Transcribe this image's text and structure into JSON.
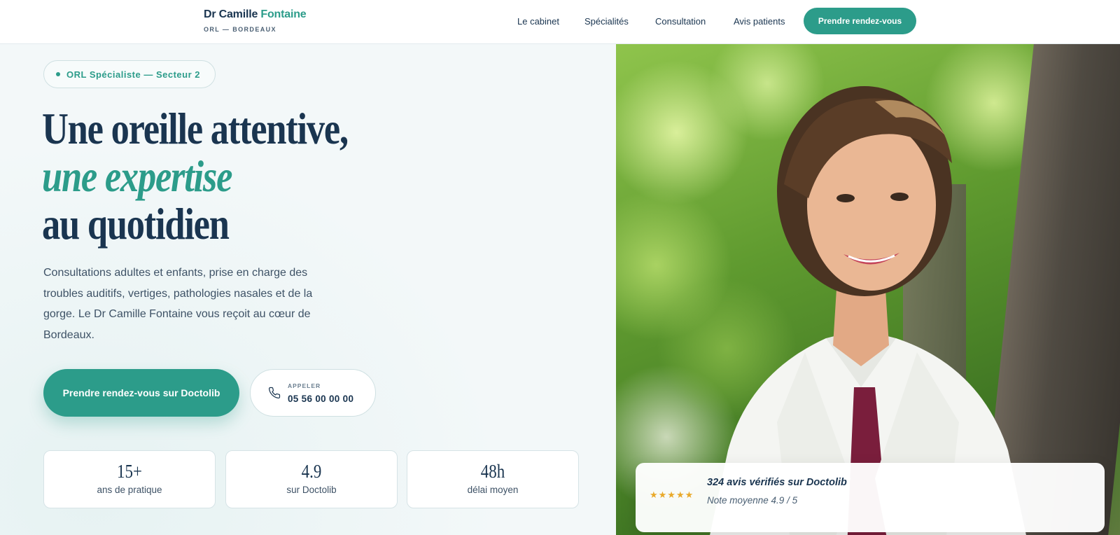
{
  "header": {
    "brand_first": "Dr Camille",
    "brand_accent": "Fontaine",
    "brand_sub": "ORL — BORDEAUX",
    "nav": [
      "Le cabinet",
      "Spécialités",
      "Consultation",
      "Avis patients"
    ],
    "cta": "Prendre rendez-vous"
  },
  "hero": {
    "badge": "ORL Spécialiste — Secteur 2",
    "title_line1": "Une oreille attentive,",
    "title_line2": "une expertise",
    "title_line3": "au quotidien",
    "lead": "Consultations adultes et enfants, prise en charge des troubles auditifs, vertiges, pathologies nasales et de la gorge. Le Dr Camille Fontaine vous reçoit au cœur de Bordeaux.",
    "cta_primary": "Prendre rendez-vous sur Doctolib",
    "call_label": "APPELER",
    "call_number": "05 56 00 00 00"
  },
  "stats": [
    {
      "value": "15+",
      "label": "ans de pratique"
    },
    {
      "value": "4.9",
      "label": "sur Doctolib"
    },
    {
      "value": "48h",
      "label": "délai moyen"
    }
  ],
  "review": {
    "stars": "★★★★★",
    "title": "324 avis vérifiés sur Doctolib",
    "subtitle": "Note moyenne 4.9 / 5"
  },
  "colors": {
    "accent": "#2c9c8a",
    "navy": "#1a3550",
    "star": "#e9a92b"
  }
}
